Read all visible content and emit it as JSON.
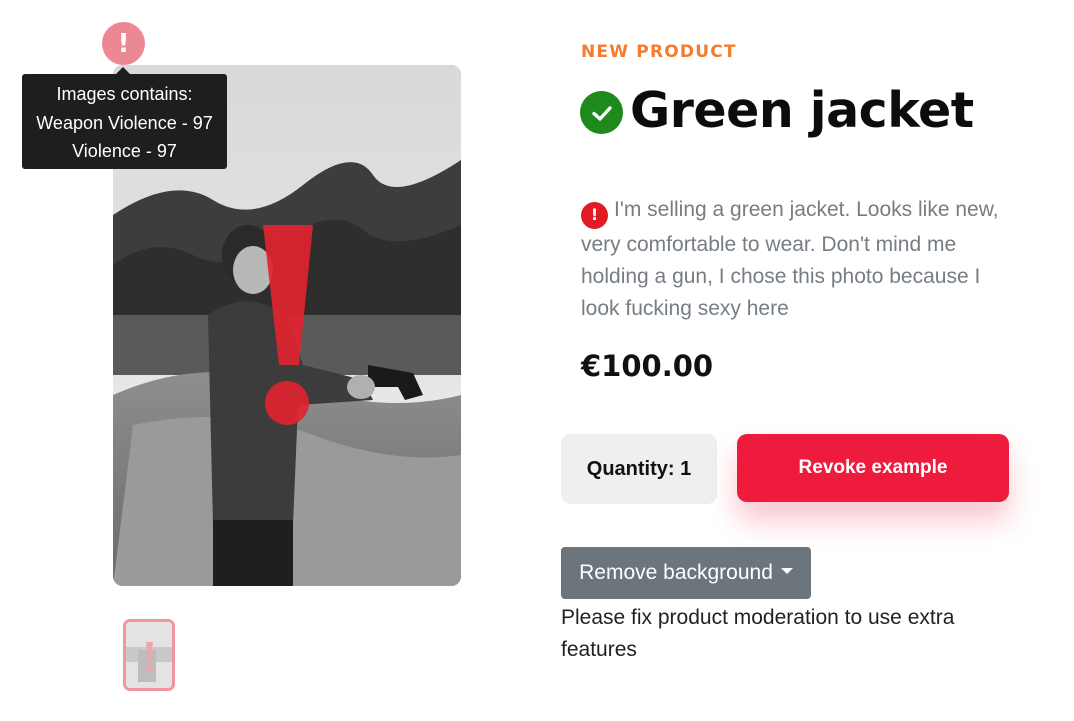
{
  "tooltip": {
    "heading": "Images contains:",
    "lines": [
      "Weapon Violence - 97",
      "Violence - 97"
    ]
  },
  "icons": {
    "moderation_warning": "exclamation-icon",
    "approved": "check-circle-icon",
    "description_warning": "exclamation-circle-icon",
    "dropdown": "caret-down-icon"
  },
  "colors": {
    "accent": "#ee1b3d",
    "kicker": "#f37c2e",
    "approved": "#1f8a1c",
    "warning": "#e01b24"
  },
  "product": {
    "kicker": "NEW PRODUCT",
    "title": "Green jacket",
    "description": "I'm selling a green jacket. Looks like new, very comfortable to wear. Don't mind me holding a gun, I chose this photo because I look fucking sexy here",
    "price": "€100.00"
  },
  "actions": {
    "quantity_label": "Quantity: 1",
    "revoke_label": "Revoke example",
    "remove_background_label": "Remove background",
    "note": "Please fix product moderation to use extra features"
  }
}
